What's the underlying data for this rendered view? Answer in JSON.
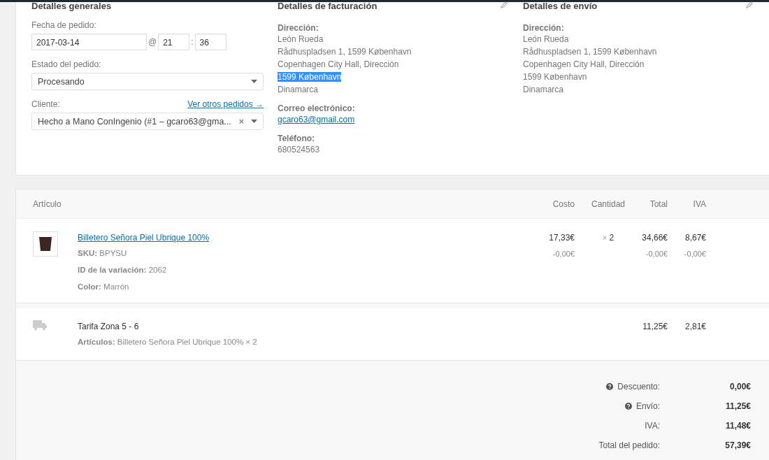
{
  "general": {
    "heading": "Detalles generales",
    "date_label": "Fecha de pedido:",
    "date": "2017-03-14",
    "at": "@",
    "hour": "21",
    "colon": ":",
    "minute": "36",
    "status_label": "Estado del pedido:",
    "status_value": "Procesando",
    "client_label": "Cliente:",
    "client_link": "Ver otros pedidos →",
    "client_value": "Hecho a Mano ConIngenio (#1 – gcaro63@gma...",
    "client_clear": "×"
  },
  "billing": {
    "heading": "Detalles de facturación",
    "address_label": "Dirección:",
    "address_lines": [
      {
        "text": "León Rueda",
        "highlighted": false
      },
      {
        "text": "Rådhuspladsen 1, 1599 København",
        "highlighted": false
      },
      {
        "text": "Copenhagen City Hall, Dirección",
        "highlighted": false
      },
      {
        "text": "1599 København",
        "highlighted": true
      },
      {
        "text": "Dinamarca",
        "highlighted": false
      }
    ],
    "email_label": "Correo electrónico:",
    "email": "gcaro63@gmail.com",
    "phone_label": "Teléfono:",
    "phone": "680524563"
  },
  "shipping": {
    "heading": "Detalles de envío",
    "address_label": "Dirección:",
    "address_lines": [
      {
        "text": "León Rueda",
        "highlighted": false
      },
      {
        "text": "Rådhuspladsen 1, 1599 København",
        "highlighted": false
      },
      {
        "text": "Copenhagen City Hall, Dirección",
        "highlighted": false
      },
      {
        "text": "1599 København",
        "highlighted": false
      },
      {
        "text": "Dinamarca",
        "highlighted": false
      }
    ]
  },
  "items": {
    "columns": [
      "Artículo",
      "Costo",
      "Cantidad",
      "Total",
      "IVA"
    ],
    "products": [
      {
        "name": "Billetero Señora Piel Ubrique 100%",
        "meta": [
          {
            "label": "SKU:",
            "value": "BPYSU"
          },
          {
            "label": "ID de la variación:",
            "value": "2062"
          },
          {
            "label": "Color:",
            "value": "Marrón"
          }
        ],
        "cost": "17,33€",
        "cost_refund": "-0,00€",
        "qty_sign": "×",
        "qty": "2",
        "total": "34,66€",
        "total_refund": "-0,00€",
        "tax": "8,67€",
        "tax_refund": "-0,00€"
      }
    ],
    "shipping_lines": [
      {
        "name": "Tarifa Zona 5 - 6",
        "meta_label": "Artículos:",
        "meta_value": "Billetero Señora Piel Ubrique 100% × 2",
        "total": "11,25€",
        "tax": "2,81€"
      }
    ]
  },
  "totals": [
    {
      "label": "Descuento:",
      "value": "0,00€",
      "help": true
    },
    {
      "label": "Envío:",
      "value": "11,25€",
      "help": true
    },
    {
      "label": "IVA:",
      "value": "11,48€",
      "help": false
    },
    {
      "label": "Total del pedido:",
      "value": "57,39€",
      "help": false
    }
  ]
}
